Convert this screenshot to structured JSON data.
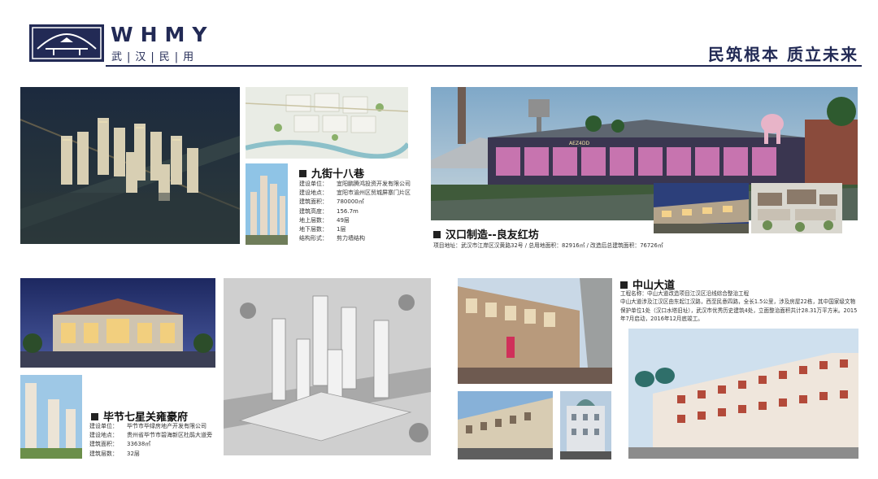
{
  "header": {
    "logo_en": "WHMY",
    "logo_cn": "武|汉|民|用",
    "slogan": "民筑根本  质立未来"
  },
  "projects": {
    "jiujie": {
      "title": "九街十八巷",
      "fields": [
        {
          "k": "建设单位：",
          "v": "宜阳鹏腾鸿投资开发有限公司"
        },
        {
          "k": "建设地点：",
          "v": "宜阳市渝州区贸城屏寨门片区"
        },
        {
          "k": "建筑面积：",
          "v": "780000㎡"
        },
        {
          "k": "建筑高度：",
          "v": "156.7m"
        },
        {
          "k": "地上层数：",
          "v": "49层"
        },
        {
          "k": "地下层数：",
          "v": "1层"
        },
        {
          "k": "结构形式：",
          "v": "剪力墙结构"
        }
      ]
    },
    "hankou": {
      "title": "汉口制造--良友红坊",
      "meta": "项目地址：武汉市江岸区汉黄路32号  /  总用地面积：82916㎡  /  改造后总建筑面积：76726㎡"
    },
    "zhongshan": {
      "title": "中山大道",
      "desc": "工程名称：中山大道改造项目江汉区沿线综合整治工程\n中山大道涉及江汉区由东起江汉路，西至民意四路，全长1.5公里，涉及房屋22栋，其中国家级文物保护单位1处（汉口水塔旧址），武汉市优秀历史建筑4处，立面整治面积共计28.31万平方米。2015年7月启动，2016年12月底竣工。"
    },
    "bijie": {
      "title": "毕节七星关雍豪府",
      "fields": [
        {
          "k": "建设单位：",
          "v": "毕节市毕绿房地产开发有限公司"
        },
        {
          "k": "建设地点：",
          "v": "贵州省毕节市碧海新区杜鹃大道旁"
        },
        {
          "k": "建筑面积：",
          "v": "33638㎡"
        },
        {
          "k": "建筑层数：",
          "v": "32层"
        }
      ]
    }
  },
  "photo_labels": {
    "cafe_sign": "AEZ4DD"
  },
  "colors": {
    "brand_navy": "#222a55",
    "accent_red": "#b03a2e"
  }
}
